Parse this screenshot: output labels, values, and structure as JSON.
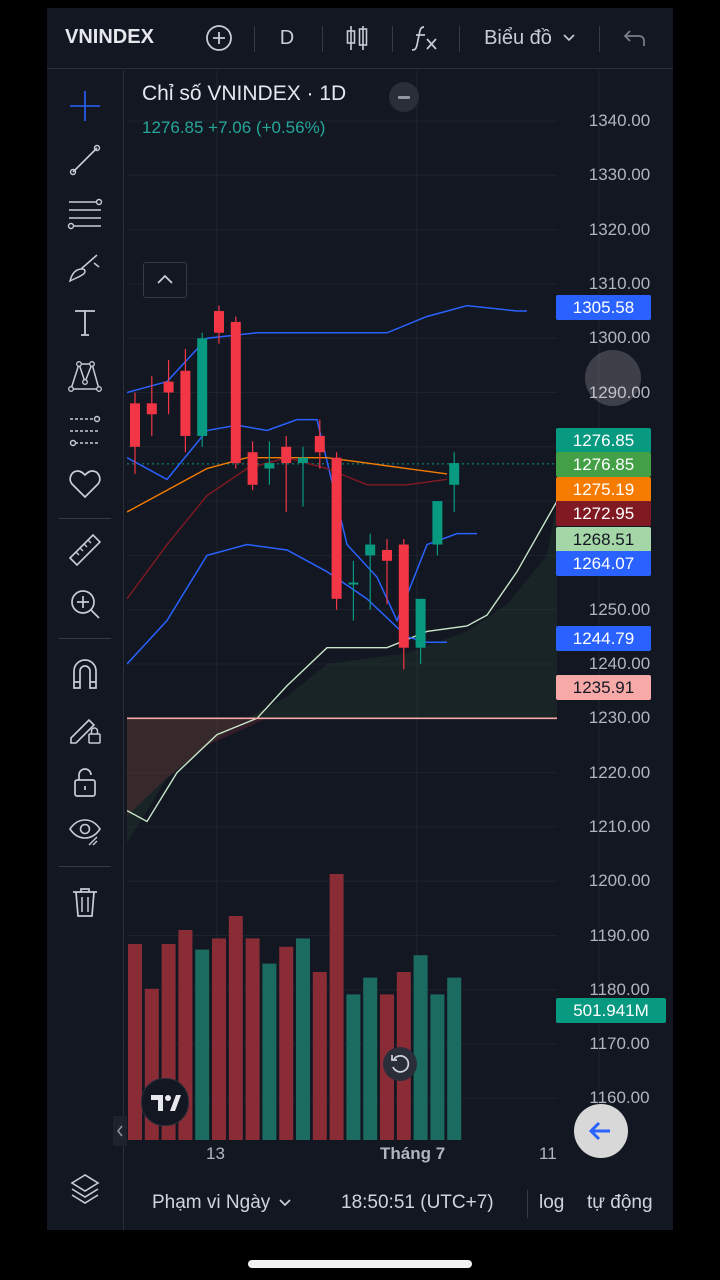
{
  "topbar": {
    "symbol": "VNINDEX",
    "interval": "D",
    "indicator_icon": "fx-icon",
    "chart_type_icon": "candles-icon",
    "chart_menu_label": "Biểu đồ"
  },
  "legend": {
    "title": "Chỉ số VNINDEX · 1D",
    "quote": "1276.85  +7.06 (+0.56%)"
  },
  "price_axis": {
    "ticks": [
      "1340.00",
      "1330.00",
      "1320.00",
      "1310.00",
      "1300.00",
      "1290.00",
      "1250.00",
      "1240.00",
      "1230.00",
      "1220.00",
      "1210.00",
      "1200.00",
      "1190.00",
      "1180.00",
      "1170.00",
      "1160.00"
    ],
    "tags": [
      {
        "label": "1305.58",
        "color": "#2962ff"
      },
      {
        "label": "1276.85",
        "color": "#089981"
      },
      {
        "label": "1276.85",
        "color": "#43a047"
      },
      {
        "label": "1275.19",
        "color": "#f57c00"
      },
      {
        "label": "1272.95",
        "color": "#801922"
      },
      {
        "label": "1268.51",
        "color": "#a5d6a7"
      },
      {
        "label": "1264.07",
        "color": "#2962ff"
      },
      {
        "label": "1244.79",
        "color": "#2962ff"
      },
      {
        "label": "1235.91",
        "color": "#f7a9a8"
      },
      {
        "label": "501.941M",
        "color": "#089981"
      }
    ]
  },
  "time_axis": {
    "labels": [
      "13",
      "Tháng 7",
      "11"
    ]
  },
  "bottom": {
    "range_label": "Phạm vi Ngày",
    "time": "18:50:51 (UTC+7)",
    "log_label": "log",
    "auto_label": "tự động"
  },
  "tools": [
    "crosshair-icon",
    "trend-line-icon",
    "fib-icon",
    "brush-icon",
    "text-icon",
    "pattern-icon",
    "prediction-icon",
    "favorite-icon",
    "ruler-icon",
    "zoom-in-icon",
    "magnet-icon",
    "lock-drawings-icon",
    "unlock-icon",
    "eye-icon",
    "trash-icon",
    "layers-icon"
  ],
  "chart_data": {
    "type": "candlestick",
    "ylim": [
      1155,
      1345
    ],
    "candles": [
      {
        "o": 1280,
        "h": 1290,
        "l": 1275,
        "c": 1288,
        "up": false
      },
      {
        "o": 1288,
        "h": 1293,
        "l": 1282,
        "c": 1286,
        "up": false
      },
      {
        "o": 1292,
        "h": 1296,
        "l": 1286,
        "c": 1290,
        "up": false
      },
      {
        "o": 1294,
        "h": 1298,
        "l": 1279,
        "c": 1282,
        "up": false
      },
      {
        "o": 1282,
        "h": 1301,
        "l": 1280,
        "c": 1300,
        "up": true
      },
      {
        "o": 1305,
        "h": 1306,
        "l": 1299,
        "c": 1301,
        "up": false
      },
      {
        "o": 1303,
        "h": 1304,
        "l": 1276,
        "c": 1277,
        "up": false
      },
      {
        "o": 1279,
        "h": 1281,
        "l": 1272,
        "c": 1273,
        "up": false
      },
      {
        "o": 1276,
        "h": 1281,
        "l": 1273,
        "c": 1277,
        "up": true
      },
      {
        "o": 1280,
        "h": 1282,
        "l": 1268,
        "c": 1277,
        "up": false
      },
      {
        "o": 1277,
        "h": 1280,
        "l": 1269,
        "c": 1278,
        "up": true
      },
      {
        "o": 1282,
        "h": 1285,
        "l": 1276,
        "c": 1279,
        "up": false
      },
      {
        "o": 1278,
        "h": 1279,
        "l": 1250,
        "c": 1252,
        "up": false
      },
      {
        "o": 1255,
        "h": 1259,
        "l": 1248,
        "c": 1255,
        "up": true
      },
      {
        "o": 1260,
        "h": 1264,
        "l": 1250,
        "c": 1262,
        "up": true
      },
      {
        "o": 1261,
        "h": 1263,
        "l": 1251,
        "c": 1259,
        "up": false
      },
      {
        "o": 1262,
        "h": 1263,
        "l": 1239,
        "c": 1243,
        "up": false
      },
      {
        "o": 1243,
        "h": 1252,
        "l": 1240,
        "c": 1252,
        "up": true
      },
      {
        "o": 1262,
        "h": 1270,
        "l": 1260,
        "c": 1270,
        "up": true
      },
      {
        "o": 1273,
        "h": 1279,
        "l": 1268,
        "c": 1277,
        "up": true
      }
    ],
    "volume": [
      70,
      54,
      70,
      75,
      68,
      72,
      80,
      72,
      63,
      69,
      72,
      60,
      95,
      52,
      58,
      52,
      60,
      66,
      52,
      58
    ],
    "volume_up": [
      false,
      false,
      false,
      false,
      true,
      false,
      false,
      false,
      true,
      false,
      true,
      false,
      false,
      true,
      true,
      false,
      false,
      true,
      true,
      true
    ]
  }
}
